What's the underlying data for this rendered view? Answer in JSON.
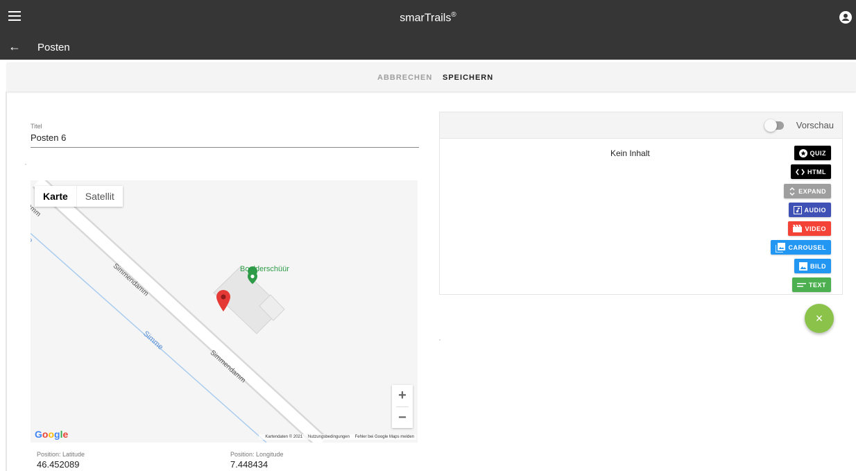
{
  "app": {
    "brand": "smarTrails",
    "brand_mark": "®"
  },
  "page": {
    "title": "Posten"
  },
  "toolbar": {
    "cancel_label": "ABBRECHEN",
    "save_label": "SPEICHERN"
  },
  "form": {
    "title_label": "Titel",
    "title_value": "Posten 6"
  },
  "map": {
    "type_map": "Karte",
    "type_satellite": "Satellit",
    "poi": "Boulderschüür",
    "street_1": "Simmendamm",
    "street_2": "Simmendamm",
    "street_3": "damm",
    "river_1": "Simme",
    "river_2": "me",
    "zoom_in": "+",
    "zoom_out": "−",
    "logo": "Google",
    "attribution": {
      "data": "Kartendaten © 2021",
      "terms": "Nutzungsbedingungen",
      "report": "Fehler bei Google Maps melden"
    }
  },
  "position": {
    "lat_label": "Position: Latitude",
    "lat_value": "46.452089",
    "lng_label": "Position: Longitude",
    "lng_value": "7.448434"
  },
  "content": {
    "preview_label": "Vorschau",
    "empty_text": "Kein Inhalt",
    "buttons": [
      {
        "label": "QUIZ",
        "color": "#000000",
        "icon": "star-circle-icon"
      },
      {
        "label": "HTML",
        "color": "#000000",
        "icon": "code-icon"
      },
      {
        "label": "EXPAND",
        "color": "#9e9e9e",
        "icon": "unfold-icon"
      },
      {
        "label": "AUDIO",
        "color": "#3f51b5",
        "icon": "music-note-icon"
      },
      {
        "label": "VIDEO",
        "color": "#f44336",
        "icon": "movie-icon"
      },
      {
        "label": "CAROUSEL",
        "color": "#2196f3",
        "icon": "collections-icon"
      },
      {
        "label": "BILD",
        "color": "#2196f3",
        "icon": "image-icon"
      },
      {
        "label": "TEXT",
        "color": "#4caf50",
        "icon": "subject-icon"
      }
    ]
  },
  "fab": {
    "label": "×",
    "color": "#8bc34a"
  }
}
